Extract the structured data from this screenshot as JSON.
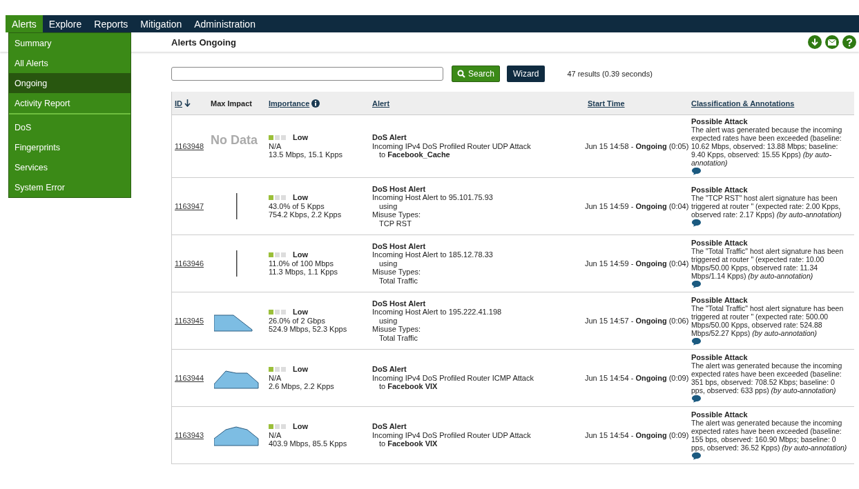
{
  "nav": [
    {
      "label": "Alerts",
      "selected": true
    },
    {
      "label": "Explore",
      "selected": false
    },
    {
      "label": "Reports",
      "selected": false
    },
    {
      "label": "Mitigation",
      "selected": false
    },
    {
      "label": "Administration",
      "selected": false
    }
  ],
  "menu": {
    "groups": [
      [
        {
          "label": "Summary",
          "selected": false
        },
        {
          "label": "All Alerts",
          "selected": false
        },
        {
          "label": "Ongoing",
          "selected": true
        },
        {
          "label": "Activity Report",
          "selected": false
        }
      ],
      [
        {
          "label": "DoS",
          "selected": false
        },
        {
          "label": "Fingerprints",
          "selected": false
        },
        {
          "label": "Services",
          "selected": false
        },
        {
          "label": "System Error",
          "selected": false
        }
      ]
    ]
  },
  "page_title": "Alerts Ongoing",
  "search": {
    "button": "Search",
    "wizard": "Wizard",
    "results": "47 results (0.39 seconds)"
  },
  "table": {
    "columns": [
      {
        "label": "ID",
        "link": true,
        "sort_down": true
      },
      {
        "label": "Max Impact",
        "link": false
      },
      {
        "label": "Importance",
        "link": true,
        "info": true
      },
      {
        "label": "Alert",
        "link": true
      },
      {
        "label": "Start Time",
        "link": true
      },
      {
        "label": "Classification & Annotations",
        "link": true
      }
    ],
    "rows": [
      {
        "id": "1163948",
        "impact": {
          "kind": "no_data",
          "text": "No Data"
        },
        "importance": {
          "stars": 1,
          "label": "Low",
          "lines": [
            "N/A",
            "13.5 Mbps, 15.1 Kpps"
          ]
        },
        "alert": {
          "title": "DoS Alert",
          "lines": [
            {
              "text": "Incoming IPv4 DoS Profiled Router UDP Attack",
              "indent": false
            },
            {
              "text": "to **Facebook_Cache**",
              "indent": true
            }
          ]
        },
        "start": "Jun 15 14:58 - **Ongoing** (0:05)",
        "classification": {
          "title": "Possible Attack",
          "text": "The alert was generated because the incoming expected rates have been exceeded (baseline: 10.62 Mbps, observed: 13.88 Mbps; baseline: 9.40 Kpps, observed: 15.55 Kpps)  *(by auto-annotation)*"
        }
      },
      {
        "id": "1163947",
        "impact": {
          "kind": "bar"
        },
        "importance": {
          "stars": 1,
          "label": "Low",
          "lines": [
            "43.0% of 5 Kpps",
            "754.2 Kbps, 2.2 Kpps"
          ]
        },
        "alert": {
          "title": "DoS Host Alert",
          "lines": [
            {
              "text": "Incoming Host Alert to 95.101.75.93",
              "indent": false
            },
            {
              "text": "using",
              "indent": true
            },
            {
              "text": "Misuse Types:",
              "indent": false
            },
            {
              "text": "TCP RST",
              "indent": true
            }
          ]
        },
        "start": "Jun 15 14:59 - **Ongoing** (0:04)",
        "classification": {
          "title": "Possible Attack",
          "text": "The \"TCP RST\" host alert signature has been triggered at router \" (expected rate: 2.00 Kpps, observed rate: 2.17 Kpps)  *(by auto-annotation)*"
        }
      },
      {
        "id": "1163946",
        "impact": {
          "kind": "bar"
        },
        "importance": {
          "stars": 1,
          "label": "Low",
          "lines": [
            "11.0% of 100 Mbps",
            "11.3 Mbps, 1.1 Kpps"
          ]
        },
        "alert": {
          "title": "DoS Host Alert",
          "lines": [
            {
              "text": "Incoming Host Alert to 185.12.78.33",
              "indent": false
            },
            {
              "text": "using",
              "indent": true
            },
            {
              "text": "Misuse Types:",
              "indent": false
            },
            {
              "text": "Total Traffic",
              "indent": true
            }
          ]
        },
        "start": "Jun 15 14:59 - **Ongoing** (0:04)",
        "classification": {
          "title": "Possible Attack",
          "text": "The \"Total Traffic\" host alert signature has been triggered at router \" (expected rate: 10.00 Mbps/50.00 Kpps, observed rate: 11.34 Mbps/1.14 Kpps)  *(by auto-annotation)*"
        }
      },
      {
        "id": "1163945",
        "impact": {
          "kind": "falling"
        },
        "importance": {
          "stars": 1,
          "label": "Low",
          "lines": [
            "26.0% of 2 Gbps",
            "524.9 Mbps, 52.3 Kpps"
          ]
        },
        "alert": {
          "title": "DoS Host Alert",
          "lines": [
            {
              "text": "Incoming Host Alert to 195.222.41.198",
              "indent": false
            },
            {
              "text": "using",
              "indent": true
            },
            {
              "text": "Misuse Types:",
              "indent": false
            },
            {
              "text": "Total Traffic",
              "indent": true
            }
          ]
        },
        "start": "Jun 15 14:57 - **Ongoing** (0:06)",
        "classification": {
          "title": "Possible Attack",
          "text": "The \"Total Traffic\" host alert signature has been triggered at router \" (expected rate: 500.00 Mbps/50.00 Kpps, observed rate: 524.88 Mbps/52.27 Kpps)  *(by auto-annotation)*"
        }
      },
      {
        "id": "1163944",
        "impact": {
          "kind": "plateau"
        },
        "importance": {
          "stars": 1,
          "label": "Low",
          "lines": [
            "N/A",
            "2.6 Mbps, 2.2 Kpps"
          ]
        },
        "alert": {
          "title": "DoS Alert",
          "lines": [
            {
              "text": "Incoming IPv4 DoS Profiled Router ICMP Attack",
              "indent": false
            },
            {
              "text": "to **Facebook VIX**",
              "indent": true
            }
          ]
        },
        "start": "Jun 15 14:54 - **Ongoing** (0:09)",
        "classification": {
          "title": "Possible Attack",
          "text": "The alert was generated because the incoming expected rates have been exceeded (baseline: 351 bps, observed: 708.52 Kbps; baseline: 0 pps, observed: 633 pps)  *(by auto-annotation)*"
        }
      },
      {
        "id": "1163943",
        "impact": {
          "kind": "hill"
        },
        "importance": {
          "stars": 1,
          "label": "Low",
          "lines": [
            "N/A",
            "403.9 Mbps, 85.5 Kpps"
          ]
        },
        "alert": {
          "title": "DoS Alert",
          "lines": [
            {
              "text": "Incoming IPv4 DoS Profiled Router UDP Attack",
              "indent": false
            },
            {
              "text": "to **Facebook VIX**",
              "indent": true
            }
          ]
        },
        "start": "Jun 15 14:54 - **Ongoing** (0:09)",
        "classification": {
          "title": "Possible Attack",
          "text": "The alert was generated because the incoming expected rates have been exceeded (baseline: 155 bps, observed: 160.90 Mbps; baseline: 0 pps, observed: 36.52 Kpps)  *(by auto-annotation)*"
        }
      }
    ]
  }
}
